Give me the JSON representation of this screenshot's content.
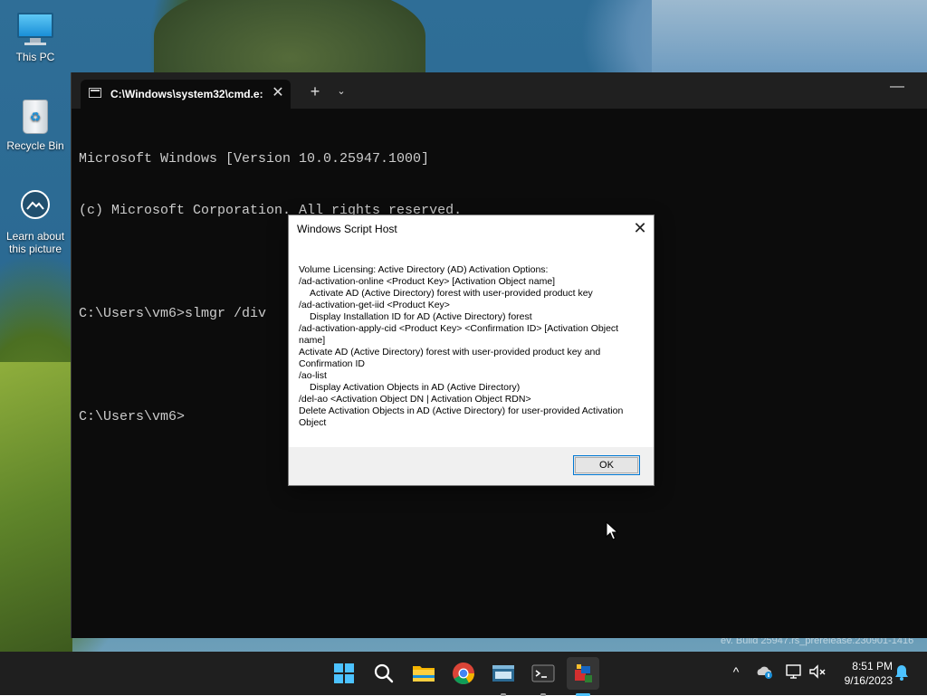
{
  "desktop": {
    "icons": [
      {
        "label": "This PC"
      },
      {
        "label": "Recycle Bin"
      },
      {
        "label": "Learn about this picture"
      }
    ],
    "watermark": "ev. Build 25947.rs_prerelease.230901-1416"
  },
  "terminal": {
    "tab_title": "C:\\Windows\\system32\\cmd.e:",
    "tab_close": "✕",
    "new_tab": "+",
    "dropdown": "⌄",
    "minimize": "—",
    "lines": [
      "Microsoft Windows [Version 10.0.25947.1000]",
      "(c) Microsoft Corporation. All rights reserved.",
      "",
      "C:\\Users\\vm6>slmgr /div",
      "",
      "C:\\Users\\vm6>"
    ]
  },
  "dialog": {
    "title": "Windows Script Host",
    "close": "✕",
    "lines": [
      {
        "text": "Volume Licensing: Active Directory (AD) Activation Options:",
        "indent": false
      },
      {
        "text": "/ad-activation-online <Product Key> [Activation Object name]",
        "indent": false
      },
      {
        "text": "Activate AD (Active Directory) forest with user-provided product key",
        "indent": true
      },
      {
        "text": "/ad-activation-get-iid <Product Key>",
        "indent": false
      },
      {
        "text": "Display Installation ID for AD (Active Directory) forest",
        "indent": true
      },
      {
        "text": "/ad-activation-apply-cid <Product Key> <Confirmation ID> [Activation Object name]",
        "indent": false
      },
      {
        "text": "Activate AD (Active Directory) forest with user-provided product key and Confirmation ID",
        "indent": true
      },
      {
        "text": "/ao-list",
        "indent": false
      },
      {
        "text": "Display Activation Objects in AD (Active Directory)",
        "indent": true
      },
      {
        "text": "/del-ao <Activation Object DN | Activation Object RDN>",
        "indent": false
      },
      {
        "text": "Delete Activation Objects in AD (Active Directory) for user-provided Activation Object",
        "indent": true
      }
    ],
    "ok_label": "OK"
  },
  "taskbar": {
    "apps": [
      {
        "name": "start-button",
        "icon": "windows-logo-icon"
      },
      {
        "name": "search-button",
        "icon": "search-icon"
      },
      {
        "name": "file-explorer-button",
        "icon": "folder-icon"
      },
      {
        "name": "chrome-button",
        "icon": "chrome-icon"
      },
      {
        "name": "app-button",
        "icon": "app-window-icon"
      },
      {
        "name": "terminal-button",
        "icon": "terminal-icon"
      },
      {
        "name": "script-host-button",
        "icon": "script-host-icon"
      }
    ],
    "tray_chevron": "^",
    "time": "8:51 PM",
    "date": "9/16/2023"
  },
  "colors": {
    "accent": "#4cc2ff",
    "terminal_bg": "#0c0c0c",
    "terminal_text": "#cccccc",
    "taskbar_bg": "#1f1f1f"
  }
}
